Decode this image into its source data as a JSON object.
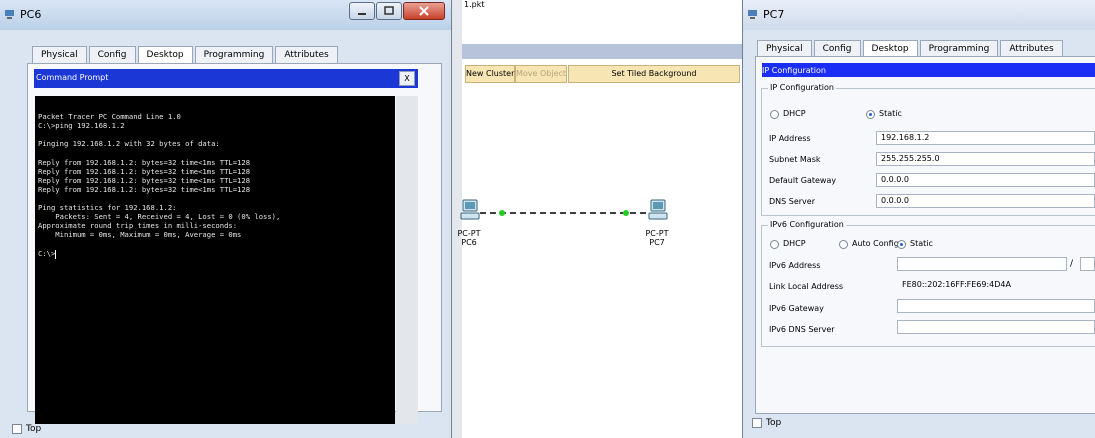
{
  "pc6": {
    "title": "PC6",
    "tabs": [
      "Physical",
      "Config",
      "Desktop",
      "Programming",
      "Attributes"
    ],
    "active_tab": "Desktop",
    "cmd_title": "Command Prompt",
    "close_label": "X",
    "terminal_lines": [
      "Packet Tracer PC Command Line 1.0",
      "C:\\>ping 192.168.1.2",
      "",
      "Pinging 192.168.1.2 with 32 bytes of data:",
      "",
      "Reply from 192.168.1.2: bytes=32 time<1ms TTL=128",
      "Reply from 192.168.1.2: bytes=32 time<1ms TTL=128",
      "Reply from 192.168.1.2: bytes=32 time<1ms TTL=128",
      "Reply from 192.168.1.2: bytes=32 time<1ms TTL=128",
      "",
      "Ping statistics for 192.168.1.2:",
      "    Packets: Sent = 4, Received = 4, Lost = 0 (0% loss),",
      "Approximate round trip times in milli-seconds:",
      "    Minimum = 0ms, Maximum = 0ms, Average = 0ms",
      "",
      "C:\\>"
    ],
    "top_label": "Top"
  },
  "workspace": {
    "file_title": "1.pkt",
    "toolbar": [
      "New Cluster",
      "Move Object",
      "Set Tiled Background"
    ],
    "devices": [
      {
        "type": "PC-PT",
        "name": "PC6"
      },
      {
        "type": "PC-PT",
        "name": "PC7"
      }
    ],
    "link_color": "#22cc22"
  },
  "pc7": {
    "title": "PC7",
    "tabs": [
      "Physical",
      "Config",
      "Desktop",
      "Programming",
      "Attributes"
    ],
    "active_tab": "Desktop",
    "header": "IP Configuration",
    "group_label": "IP Configuration",
    "dhcp_label": "DHCP",
    "static_label": "Static",
    "ip_mode": "Static",
    "ip_address_label": "IP Address",
    "ip_address": "192.168.1.2",
    "subnet_label": "Subnet Mask",
    "subnet": "255.255.255.0",
    "gateway_label": "Default Gateway",
    "gateway": "0.0.0.0",
    "dns_label": "DNS Server",
    "dns": "0.0.0.0",
    "ipv6_group_label": "IPv6 Configuration",
    "ipv6_dhcp_label": "DHCP",
    "ipv6_auto_label": "Auto Config",
    "ipv6_static_label": "Static",
    "ipv6_mode": "Static",
    "ipv6_address_label": "IPv6 Address",
    "ipv6_address": "",
    "ipv6_prefix_sep": "/",
    "link_local_label": "Link Local Address",
    "link_local": "FE80::202:16FF:FE69:4D4A",
    "ipv6_gateway_label": "IPv6 Gateway",
    "ipv6_gateway": "",
    "ipv6_dns_label": "IPv6 DNS Server",
    "ipv6_dns": "",
    "top_label": "Top"
  },
  "colors": {
    "terminal_bg": "#000000",
    "cmd_header": "#1b37d6",
    "ip_header": "#1b2ef5",
    "window_frame": "#dbe5f1"
  }
}
